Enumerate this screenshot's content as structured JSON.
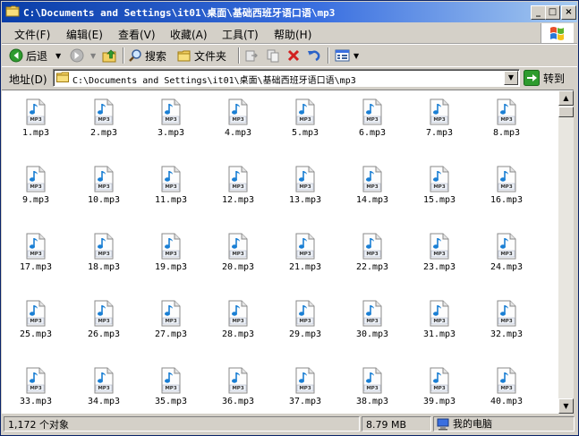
{
  "window": {
    "title": "C:\\Documents and Settings\\it01\\桌面\\基础西班牙语口语\\mp3",
    "minimize_label": "_",
    "maximize_label": "□",
    "close_label": "×"
  },
  "menu": {
    "items": [
      {
        "label": "文件(F)"
      },
      {
        "label": "编辑(E)"
      },
      {
        "label": "查看(V)"
      },
      {
        "label": "收藏(A)"
      },
      {
        "label": "工具(T)"
      },
      {
        "label": "帮助(H)"
      }
    ]
  },
  "toolbar": {
    "back_label": "后退",
    "search_label": "搜索",
    "folders_label": "文件夹"
  },
  "address": {
    "label": "地址(D)",
    "value": "C:\\Documents and Settings\\it01\\桌面\\基础西班牙语口语\\mp3",
    "go_label": "转到"
  },
  "files": [
    {
      "name": "1.mp3",
      "badge": "MP3"
    },
    {
      "name": "2.mp3",
      "badge": "MP3"
    },
    {
      "name": "3.mp3",
      "badge": "MP3"
    },
    {
      "name": "4.mp3",
      "badge": "MP3"
    },
    {
      "name": "5.mp3",
      "badge": "MP3"
    },
    {
      "name": "6.mp3",
      "badge": "MP3"
    },
    {
      "name": "7.mp3",
      "badge": "MP3"
    },
    {
      "name": "8.mp3",
      "badge": "MP3"
    },
    {
      "name": "9.mp3",
      "badge": "MP3"
    },
    {
      "name": "10.mp3",
      "badge": "MP3"
    },
    {
      "name": "11.mp3",
      "badge": "MP3"
    },
    {
      "name": "12.mp3",
      "badge": "MP3"
    },
    {
      "name": "13.mp3",
      "badge": "MP3"
    },
    {
      "name": "14.mp3",
      "badge": "MP3"
    },
    {
      "name": "15.mp3",
      "badge": "MP3"
    },
    {
      "name": "16.mp3",
      "badge": "MP3"
    },
    {
      "name": "17.mp3",
      "badge": "MP3"
    },
    {
      "name": "18.mp3",
      "badge": "MP3"
    },
    {
      "name": "19.mp3",
      "badge": "MP3"
    },
    {
      "name": "20.mp3",
      "badge": "MP3"
    },
    {
      "name": "21.mp3",
      "badge": "MP3"
    },
    {
      "name": "22.mp3",
      "badge": "MP3"
    },
    {
      "name": "23.mp3",
      "badge": "MP3"
    },
    {
      "name": "24.mp3",
      "badge": "MP3"
    },
    {
      "name": "25.mp3",
      "badge": "MP3"
    },
    {
      "name": "26.mp3",
      "badge": "MP3"
    },
    {
      "name": "27.mp3",
      "badge": "MP3"
    },
    {
      "name": "28.mp3",
      "badge": "MP3"
    },
    {
      "name": "29.mp3",
      "badge": "MP3"
    },
    {
      "name": "30.mp3",
      "badge": "MP3"
    },
    {
      "name": "31.mp3",
      "badge": "MP3"
    },
    {
      "name": "32.mp3",
      "badge": "MP3"
    },
    {
      "name": "33.mp3",
      "badge": "MP3"
    },
    {
      "name": "34.mp3",
      "badge": "MP3"
    },
    {
      "name": "35.mp3",
      "badge": "MP3"
    },
    {
      "name": "36.mp3",
      "badge": "MP3"
    },
    {
      "name": "37.mp3",
      "badge": "MP3"
    },
    {
      "name": "38.mp3",
      "badge": "MP3"
    },
    {
      "name": "39.mp3",
      "badge": "MP3"
    },
    {
      "name": "40.mp3",
      "badge": "MP3"
    }
  ],
  "status": {
    "object_count": "1,172 个对象",
    "size": "8.79 MB",
    "location": "我的电脑"
  },
  "icons": {
    "file": "mp3-file-icon",
    "back": "back-arrow-icon",
    "forward": "forward-arrow-icon",
    "up": "up-folder-icon",
    "search": "search-icon",
    "folders": "folders-icon",
    "move": "move-to-icon",
    "copy": "copy-to-icon",
    "delete": "delete-icon",
    "undo": "undo-icon",
    "views": "views-icon",
    "go": "go-arrow-icon",
    "computer": "computer-icon"
  },
  "colors": {
    "title_bar": "#0a3ea8",
    "face": "#d4d0c8",
    "note": "#1a7fd4",
    "back_green": "#2e9b2e",
    "delete_red": "#d22020",
    "undo_blue": "#2a62c8"
  }
}
